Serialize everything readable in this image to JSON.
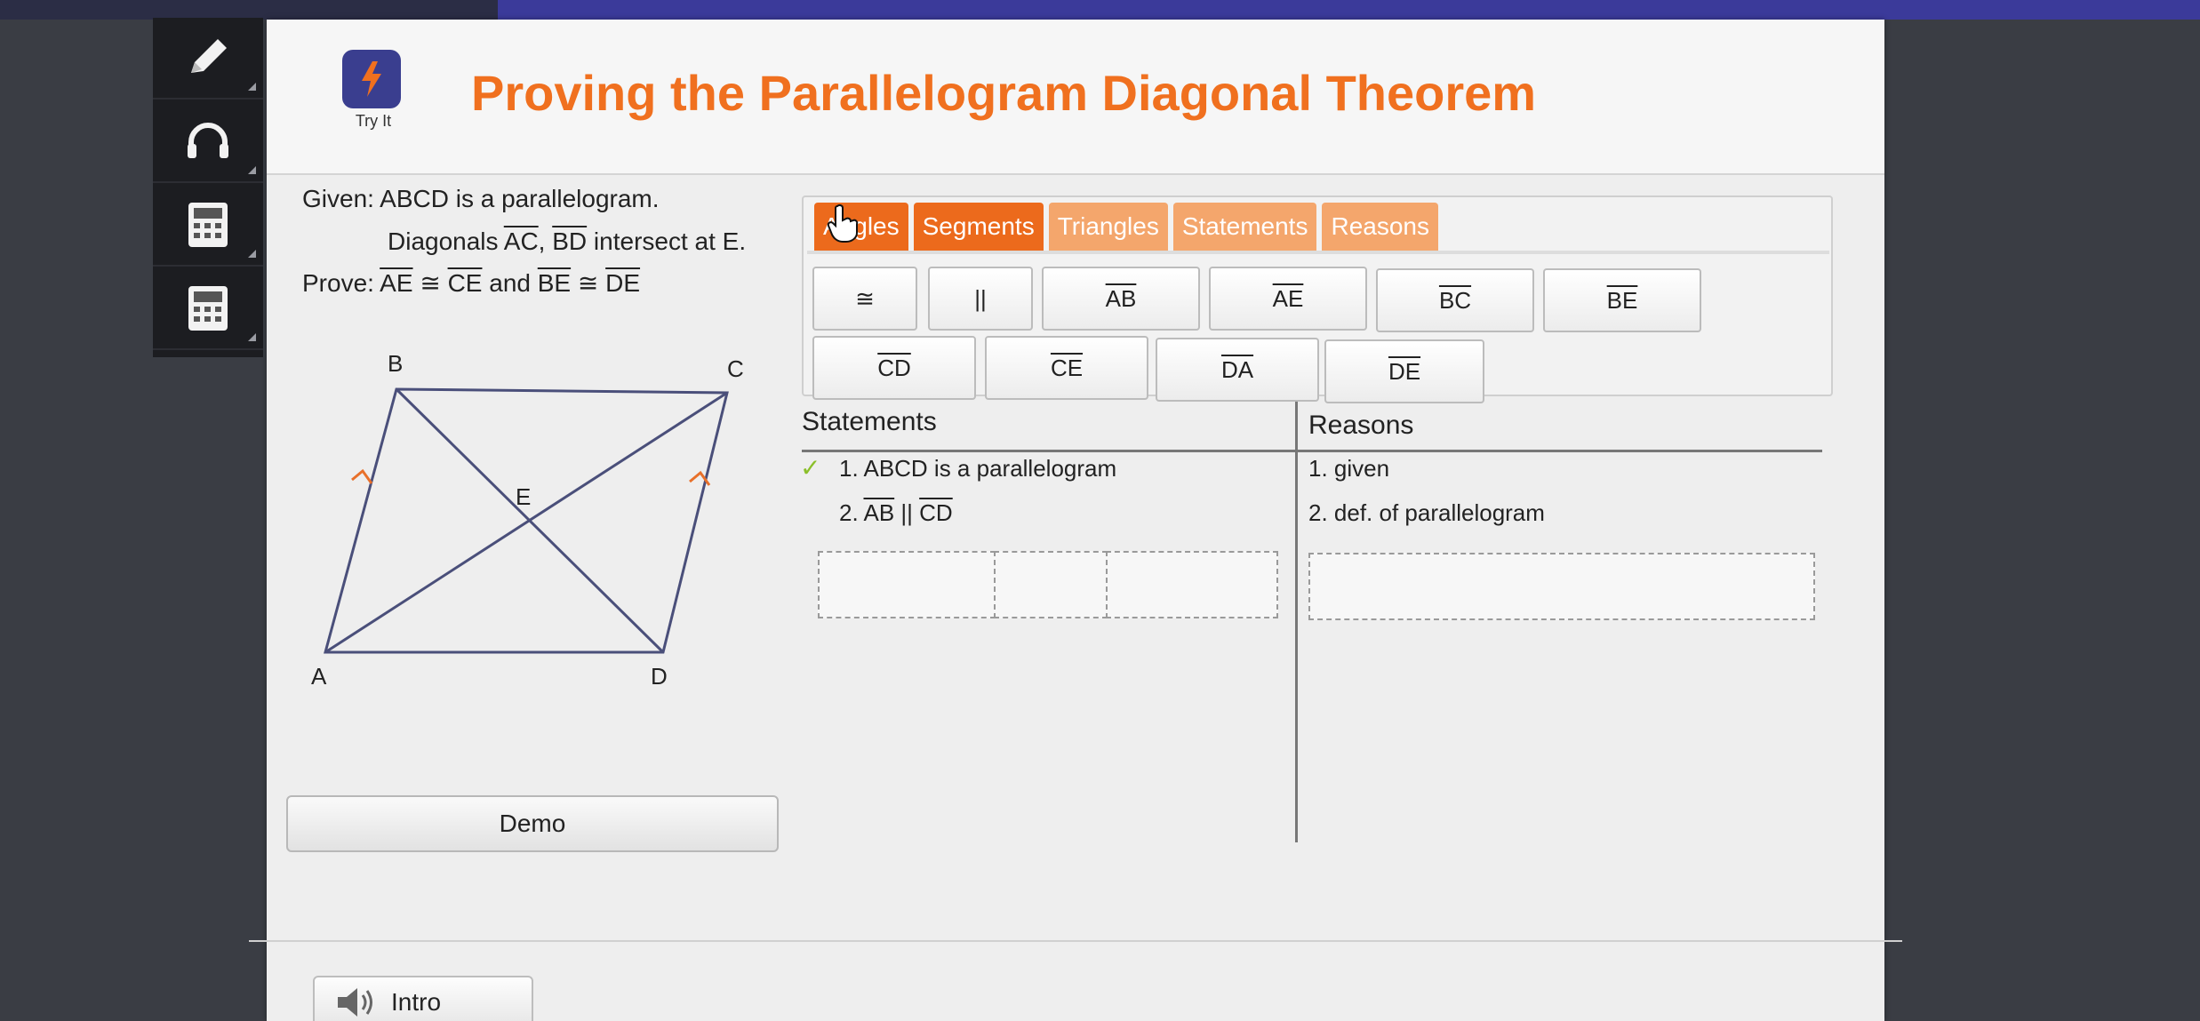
{
  "header": {
    "title": "Proving the Parallelogram Diagonal Theorem",
    "tryit_label": "Try It"
  },
  "toolbar": {
    "items": [
      {
        "icon": "pencil-icon"
      },
      {
        "icon": "headphones-icon"
      },
      {
        "icon": "calculator-icon"
      },
      {
        "icon": "calculator-icon"
      }
    ]
  },
  "problem": {
    "given_prefix": "Given:",
    "given_text": "ABCD is a parallelogram.",
    "diag_prefix": "Diagonals",
    "diag_seg1": "AC",
    "diag_sep": ",",
    "diag_seg2": "BD",
    "diag_suffix": "intersect at E.",
    "prove_prefix": "Prove:",
    "prove_seg1": "AE",
    "cong1": "≅",
    "prove_seg2": "CE",
    "and": "and",
    "prove_seg3": "BE",
    "cong2": "≅",
    "prove_seg4": "DE"
  },
  "diagram": {
    "labels": {
      "A": "A",
      "B": "B",
      "C": "C",
      "D": "D",
      "E": "E"
    },
    "line_color": "#4a4f7a",
    "arrow_color": "#e8702a"
  },
  "buttons": {
    "demo": "Demo",
    "intro": "Intro"
  },
  "tabs": [
    {
      "label": "Angles",
      "active": true
    },
    {
      "label": "Segments",
      "active": true
    },
    {
      "label": "Triangles",
      "active": false
    },
    {
      "label": "Statements",
      "active": false
    },
    {
      "label": "Reasons",
      "active": false
    }
  ],
  "symbols": {
    "row1": [
      "≅",
      "||",
      "AB",
      "AE",
      "BC",
      "BE"
    ],
    "row2": [
      "CD",
      "CE",
      "DA",
      "DE"
    ]
  },
  "proof": {
    "statements_header": "Statements",
    "reasons_header": "Reasons",
    "rows": [
      {
        "statement": "1. ABCD is a parallelogram",
        "reason": "1. given"
      },
      {
        "statement_prefix": "2.",
        "seg1": "AB",
        "op": "||",
        "seg2": "CD",
        "reason": "2. def. of parallelogram"
      }
    ],
    "check": "✓"
  },
  "colors": {
    "accent": "#ec6a1c",
    "tab_inactive": "#f4a66c",
    "title": "#f0701f",
    "check": "#8bbf2a"
  }
}
